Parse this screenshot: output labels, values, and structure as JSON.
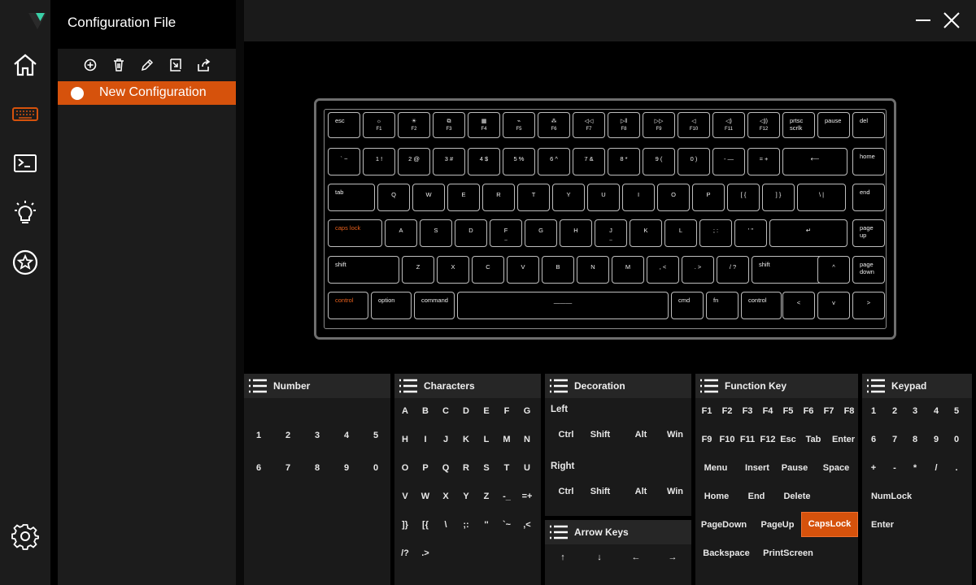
{
  "app": {
    "title": "Configuration File"
  },
  "panel": {
    "items": [
      {
        "label": "New Configuration",
        "selected": true
      }
    ]
  },
  "keyboard": {
    "rows": [
      [
        {
          "t": "esc"
        },
        {
          "i": "☼",
          "s": "F1"
        },
        {
          "i": "☀",
          "s": "F2"
        },
        {
          "i": "⧉",
          "s": "F3"
        },
        {
          "i": "▦",
          "s": "F4"
        },
        {
          "i": "⌁",
          "s": "F5"
        },
        {
          "i": "⁂",
          "s": "F6"
        },
        {
          "i": "◁◁",
          "s": "F7"
        },
        {
          "i": "▷‖",
          "s": "F8"
        },
        {
          "i": "▷▷",
          "s": "F9"
        },
        {
          "i": "◁",
          "s": "F10"
        },
        {
          "i": "◁)",
          "s": "F11"
        },
        {
          "i": "◁))",
          "s": "F12"
        },
        {
          "t": "prtsc\nscrlk"
        },
        {
          "t": "pause"
        },
        {
          "t": "del"
        }
      ],
      [
        {
          "c": "` ~"
        },
        {
          "c": "1 !"
        },
        {
          "c": "2 @"
        },
        {
          "c": "3 #"
        },
        {
          "c": "4 $"
        },
        {
          "c": "5 %"
        },
        {
          "c": "6 ^"
        },
        {
          "c": "7 &"
        },
        {
          "c": "8 *"
        },
        {
          "c": "9 ("
        },
        {
          "c": "0 )"
        },
        {
          "c": "- —"
        },
        {
          "c": "= +"
        },
        {
          "c": "⟵"
        },
        {
          "t": "home"
        }
      ],
      [
        {
          "t": "tab"
        },
        {
          "c": "Q"
        },
        {
          "c": "W"
        },
        {
          "c": "E"
        },
        {
          "c": "R"
        },
        {
          "c": "T"
        },
        {
          "c": "Y"
        },
        {
          "c": "U"
        },
        {
          "c": "I"
        },
        {
          "c": "O"
        },
        {
          "c": "P"
        },
        {
          "c": "[ {"
        },
        {
          "c": "] }"
        },
        {
          "c": "\\ |"
        },
        {
          "t": "end"
        }
      ],
      [
        {
          "t": "caps lock",
          "orange": true
        },
        {
          "c": "A"
        },
        {
          "c": "S"
        },
        {
          "c": "D"
        },
        {
          "c": "F",
          "s": "_"
        },
        {
          "c": "G"
        },
        {
          "c": "H"
        },
        {
          "c": "J",
          "s": "_"
        },
        {
          "c": "K"
        },
        {
          "c": "L"
        },
        {
          "c": "; :"
        },
        {
          "c": "' \""
        },
        {
          "c": "↵"
        },
        {
          "t": "page\nup"
        }
      ],
      [
        {
          "t": "shift"
        },
        {
          "c": "Z"
        },
        {
          "c": "X"
        },
        {
          "c": "C"
        },
        {
          "c": "V"
        },
        {
          "c": "B"
        },
        {
          "c": "N"
        },
        {
          "c": "M"
        },
        {
          "c": ", <"
        },
        {
          "c": ". >"
        },
        {
          "c": "/ ?"
        },
        {
          "t": "shift"
        },
        {
          "c": "^"
        },
        {
          "t": "page\ndown"
        }
      ],
      [
        {
          "t": "control",
          "orange": true
        },
        {
          "t": "option"
        },
        {
          "t": "command"
        },
        {
          "c": "———"
        },
        {
          "t": "cmd"
        },
        {
          "t": "fn"
        },
        {
          "t": "control"
        },
        {
          "c": "<"
        },
        {
          "c": "v"
        },
        {
          "c": ">"
        }
      ]
    ]
  },
  "sections": {
    "number": {
      "title": "Number",
      "items": [
        "1",
        "2",
        "3",
        "4",
        "5",
        "6",
        "7",
        "8",
        "9",
        "0"
      ]
    },
    "characters": {
      "title": "Characters",
      "items": [
        "A",
        "B",
        "C",
        "D",
        "E",
        "F",
        "G",
        "H",
        "I",
        "J",
        "K",
        "L",
        "M",
        "N",
        "O",
        "P",
        "Q",
        "R",
        "S",
        "T",
        "U",
        "V",
        "W",
        "X",
        "Y",
        "Z",
        "-_",
        "=+",
        "]}",
        "[{",
        "\\",
        ";:",
        "''",
        "`~",
        ",<",
        "/?",
        ".>"
      ]
    },
    "decoration": {
      "title": "Decoration",
      "left_label": "Left",
      "right_label": "Right",
      "left": [
        "Ctrl",
        "Shift",
        "Alt",
        "Win"
      ],
      "right": [
        "Ctrl",
        "Shift",
        "Alt",
        "Win"
      ]
    },
    "arrow": {
      "title": "Arrow Keys",
      "items": [
        "↑",
        "↓",
        "←",
        "→"
      ]
    },
    "function": {
      "title": "Function Key",
      "items": [
        "F1",
        "F2",
        "F3",
        "F4",
        "F5",
        "F6",
        "F7",
        "F8",
        "F9",
        "F10",
        "F11",
        "F12",
        "Esc",
        "Tab",
        "Enter",
        "Menu",
        "Insert",
        "Pause",
        "Space",
        "Home",
        "End",
        "Delete",
        "PageDown",
        "PageUp",
        "CapsLock",
        "Backspace",
        "PrintScreen"
      ],
      "selected": "CapsLock"
    },
    "keypad": {
      "title": "Keypad",
      "items": [
        "1",
        "2",
        "3",
        "4",
        "5",
        "6",
        "7",
        "8",
        "9",
        "0",
        "+",
        "-",
        "*",
        "/",
        ".",
        "NumLock",
        "Enter"
      ]
    }
  },
  "colors": {
    "accent": "#d6520c",
    "rail": "#1c1c1c",
    "section": "#1a1a1a"
  }
}
